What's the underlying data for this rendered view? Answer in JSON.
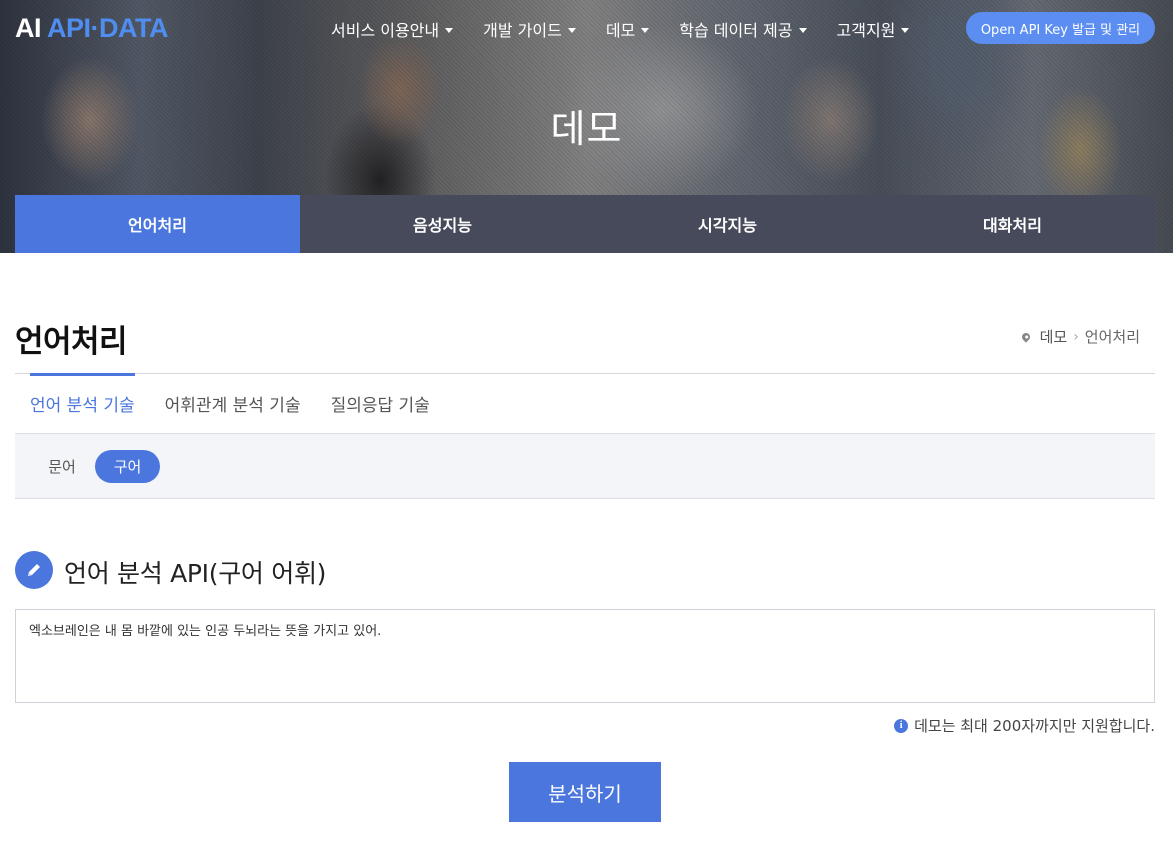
{
  "header": {
    "logo_ai": "AI",
    "logo_apidata": "API·DATA",
    "nav": [
      {
        "label": "서비스 이용안내"
      },
      {
        "label": "개발 가이드"
      },
      {
        "label": "데모"
      },
      {
        "label": "학습 데이터 제공"
      },
      {
        "label": "고객지원"
      }
    ],
    "open_api_button": "Open API Key 발급 및 관리"
  },
  "hero": {
    "title": "데모"
  },
  "category_tabs": [
    {
      "label": "언어처리",
      "active": true
    },
    {
      "label": "음성지능",
      "active": false
    },
    {
      "label": "시각지능",
      "active": false
    },
    {
      "label": "대화처리",
      "active": false
    }
  ],
  "page": {
    "title": "언어처리",
    "breadcrumb": {
      "parent": "데모",
      "separator": "›",
      "current": "언어처리"
    }
  },
  "sub_tabs": [
    {
      "label": "언어 분석 기술",
      "active": true
    },
    {
      "label": "어휘관계 분석 기술",
      "active": false
    },
    {
      "label": "질의응답 기술",
      "active": false
    }
  ],
  "pills": [
    {
      "label": "문어",
      "active": false
    },
    {
      "label": "구어",
      "active": true
    }
  ],
  "api_section": {
    "icon": "pencil-icon",
    "title": "언어 분석 API(구어 어휘)",
    "input_value": "엑소브레인은 내 몸 바깥에 있는 인공 두뇌라는 뜻을 가지고 있어.",
    "notice_icon": "i",
    "notice": "데모는 최대 200자까지만 지원합니다.",
    "analyze_button": "분석하기"
  },
  "colors": {
    "accent": "#4a76dd",
    "tab_dark": "#474a5a",
    "open_api_button": "#5b8ef0"
  }
}
